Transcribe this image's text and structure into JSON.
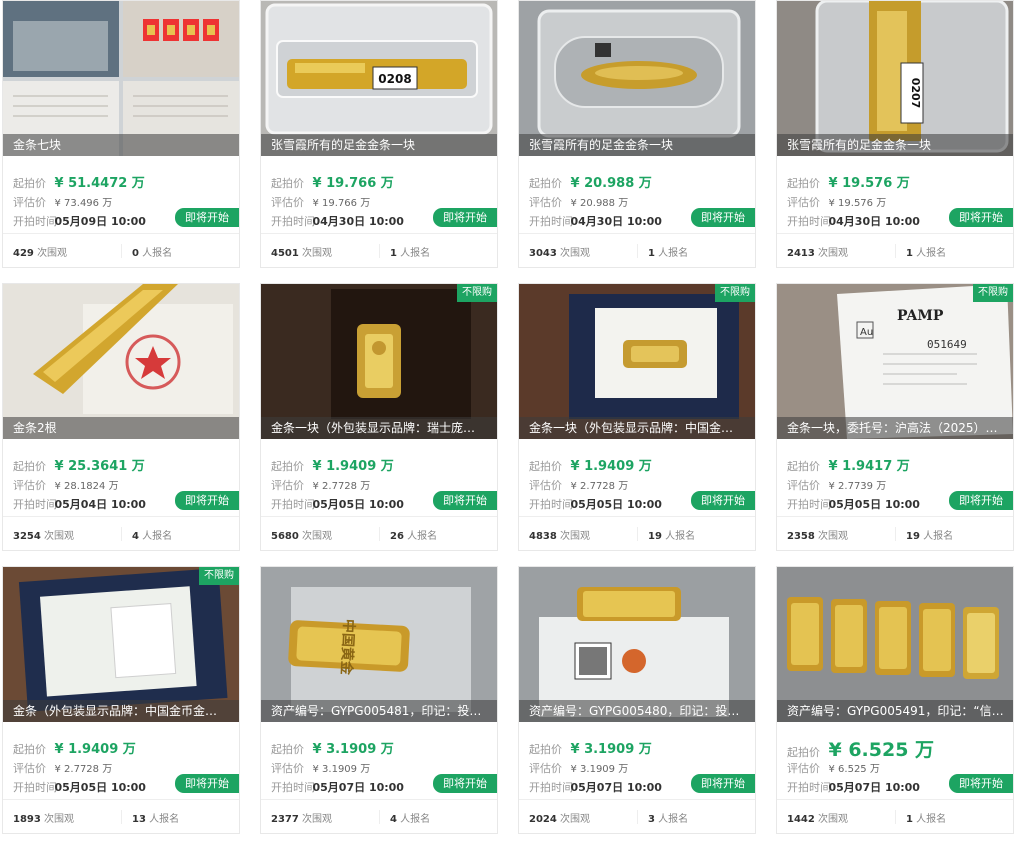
{
  "labels": {
    "start": "起拍价",
    "estimate": "评估价",
    "time": "开拍时间",
    "views_suffix": "次围观",
    "signups_suffix": "人报名",
    "button": "即将开始",
    "unlimited": "不限购"
  },
  "cards": [
    {
      "title": "金条七块",
      "start": "¥ 51.4472 万",
      "estimate": "¥ 73.496 万",
      "time": "05月09日 10:00",
      "views": "429",
      "signups": "0",
      "tag": ""
    },
    {
      "title": "张雪霞所有的足金金条一块",
      "start": "¥ 19.766 万",
      "estimate": "¥ 19.766 万",
      "time": "04月30日 10:00",
      "views": "4501",
      "signups": "1",
      "tag": ""
    },
    {
      "title": "张雪霞所有的足金金条一块",
      "start": "¥ 20.988 万",
      "estimate": "¥ 20.988 万",
      "time": "04月30日 10:00",
      "views": "3043",
      "signups": "1",
      "tag": ""
    },
    {
      "title": "张雪霞所有的足金金条一块",
      "start": "¥ 19.576 万",
      "estimate": "¥ 19.576 万",
      "time": "04月30日 10:00",
      "views": "2413",
      "signups": "1",
      "tag": ""
    },
    {
      "title": "金条2根",
      "start": "¥ 25.3641 万",
      "estimate": "¥ 28.1824 万",
      "time": "05月04日 10:00",
      "views": "3254",
      "signups": "4",
      "tag": ""
    },
    {
      "title": "金条一块（外包装显示品牌：瑞士庞…",
      "start": "¥ 1.9409 万",
      "estimate": "¥ 2.7728 万",
      "time": "05月05日 10:00",
      "views": "5680",
      "signups": "26",
      "tag": "不限购"
    },
    {
      "title": "金条一块（外包装显示品牌：中国金…",
      "start": "¥ 1.9409 万",
      "estimate": "¥ 2.7728 万",
      "time": "05月05日 10:00",
      "views": "4838",
      "signups": "19",
      "tag": "不限购"
    },
    {
      "title": "金条一块，委托号：沪高法（2025）…",
      "start": "¥ 1.9417 万",
      "estimate": "¥ 2.7739 万",
      "time": "05月05日 10:00",
      "views": "2358",
      "signups": "19",
      "tag": "不限购"
    },
    {
      "title": "金条（外包装显示品牌：中国金币金…",
      "start": "¥ 1.9409 万",
      "estimate": "¥ 2.7728 万",
      "time": "05月05日 10:00",
      "views": "1893",
      "signups": "13",
      "tag": "不限购"
    },
    {
      "title": "资产编号：GYPG005481，印记：投…",
      "start": "¥ 3.1909 万",
      "estimate": "¥ 3.1909 万",
      "time": "05月07日 10:00",
      "views": "2377",
      "signups": "4",
      "tag": ""
    },
    {
      "title": "资产编号：GYPG005480，印记：投…",
      "start": "¥ 3.1909 万",
      "estimate": "¥ 3.1909 万",
      "time": "05月07日 10:00",
      "views": "2024",
      "signups": "3",
      "tag": ""
    },
    {
      "title": "资产编号：GYPG005491，印记：“信”…",
      "start": "¥ 6.525 万",
      "estimate": "¥ 6.525 万",
      "time": "05月07日 10:00",
      "views": "1442",
      "signups": "1",
      "tag": ""
    }
  ],
  "photo_texts": {
    "lot_0208": "0208",
    "lot_0207": "0207",
    "pamp": "PAMP",
    "au": "Au",
    "cert_no": "051649",
    "zhongguo_huangjin": "中国黄金"
  }
}
